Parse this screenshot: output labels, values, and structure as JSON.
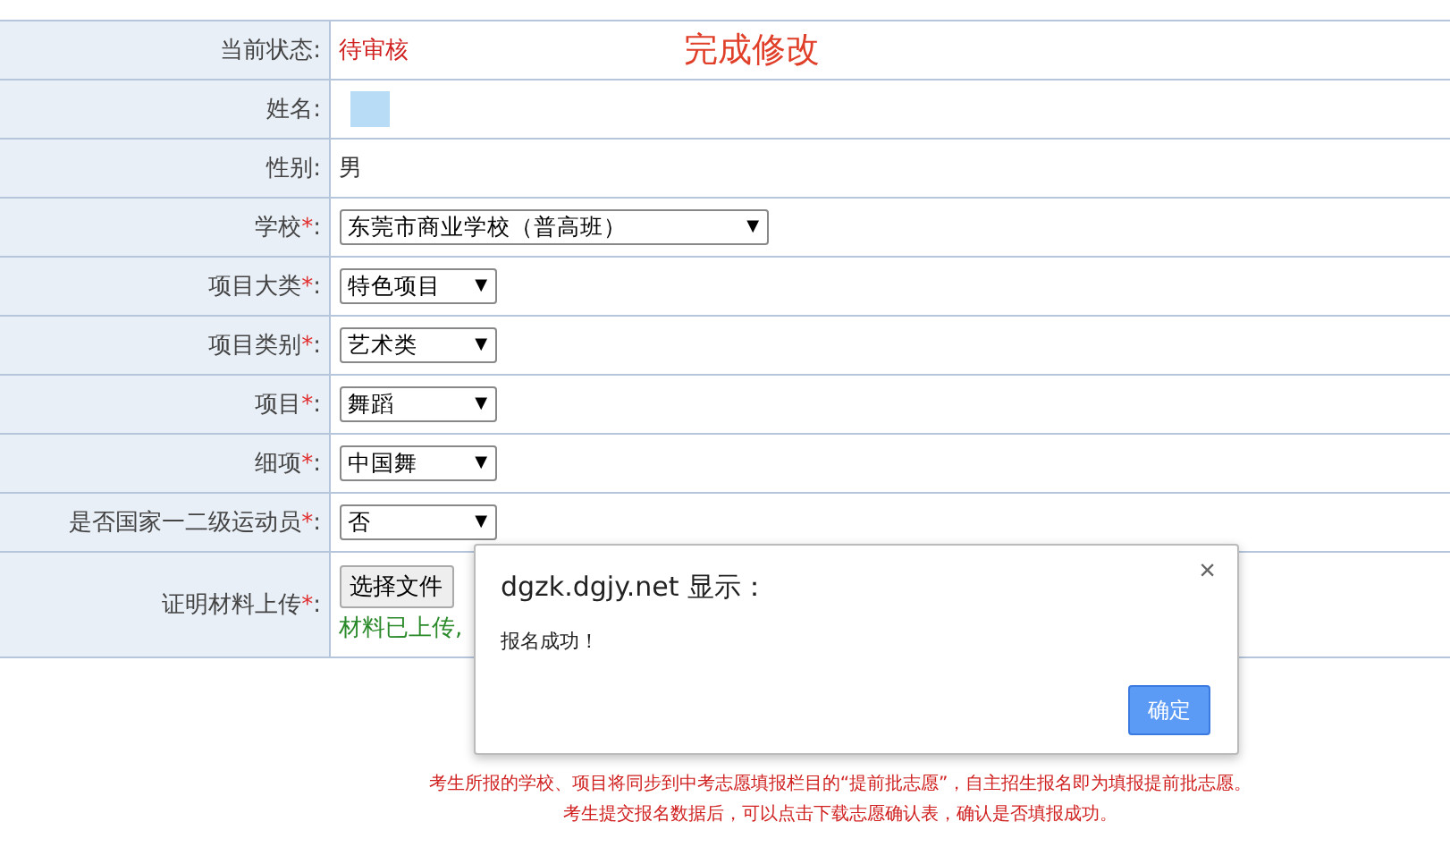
{
  "form": {
    "rows": [
      {
        "label": "当前状态",
        "colon": ":",
        "kind": "status",
        "value": "待审核",
        "action": "完成修改"
      },
      {
        "label": "姓名",
        "colon": ":",
        "kind": "redacted"
      },
      {
        "label": "性别",
        "colon": ":",
        "kind": "text",
        "value": "男"
      },
      {
        "label": "学校",
        "asterisk": "*",
        "colon": ":",
        "kind": "select",
        "value": "东莞市商业学校（普高班）",
        "arrow": "▼",
        "wide": true
      },
      {
        "label": "项目大类",
        "asterisk": "*",
        "colon": ":",
        "kind": "select",
        "value": "特色项目",
        "arrow": "▼",
        "wide": false
      },
      {
        "label": "项目类别",
        "asterisk": "*",
        "colon": ":",
        "kind": "select",
        "value": "艺术类",
        "arrow": "▼",
        "wide": false
      },
      {
        "label": "项目",
        "asterisk": "*",
        "colon": ":",
        "kind": "select",
        "value": "舞蹈",
        "arrow": "▼",
        "wide": false
      },
      {
        "label": "细项",
        "asterisk": "*",
        "colon": ":",
        "kind": "select",
        "value": "中国舞",
        "arrow": "▼",
        "wide": false
      },
      {
        "label": "是否国家一二级运动员",
        "asterisk": "*",
        "colon": ":",
        "kind": "select",
        "value": "否",
        "arrow": "▼",
        "wide": false
      },
      {
        "label": "证明材料上传",
        "asterisk": "*",
        "colon": ":",
        "kind": "file",
        "button": "选择文件",
        "note": "材料已上传,"
      }
    ]
  },
  "notes": [
    "考生所报的学校、项目将同步到中考志愿填报栏目的“提前批志愿”，自主招生报名即为填报提前批志愿。",
    "考生提交报名数据后，可以点击下载志愿确认表，确认是否填报成功。"
  ],
  "dialog": {
    "title": "dgzk.dgjy.net 显示：",
    "message": "报名成功！",
    "close": "×",
    "button": "确定"
  }
}
